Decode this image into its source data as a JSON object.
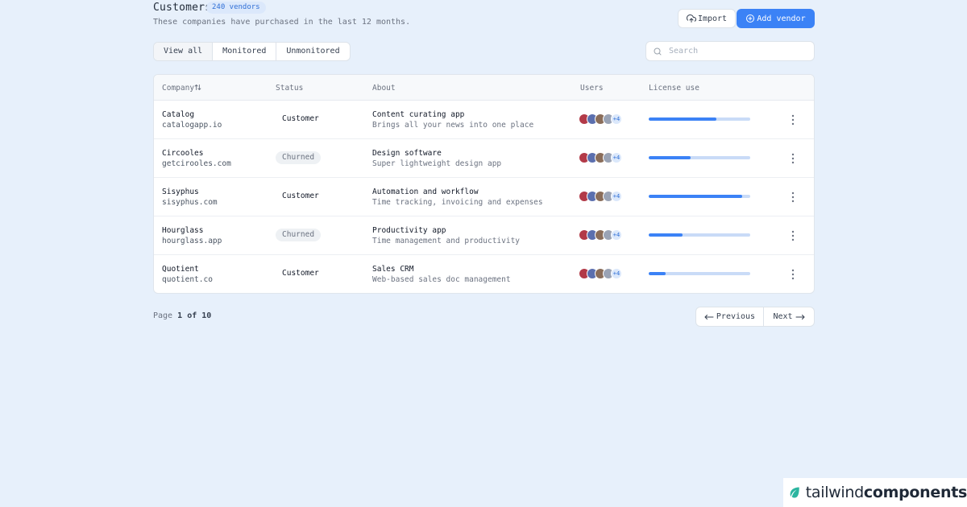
{
  "header": {
    "title": "Customers",
    "badge": "240 vendors",
    "subtitle": "These companies have purchased in the last 12 months.",
    "import_label": "Import",
    "add_label": "Add vendor"
  },
  "filters": {
    "tabs": [
      "View all",
      "Monitored",
      "Unmonitored"
    ],
    "active": "View all"
  },
  "search": {
    "placeholder": "Search"
  },
  "table": {
    "columns": {
      "company": "Company",
      "status": "Status",
      "about": "About",
      "users": "Users",
      "license": "License use"
    },
    "rows": [
      {
        "name": "Catalog",
        "domain": "catalogapp.io",
        "status": "Customer",
        "about_title": "Content curating app",
        "about_sub": "Brings all your news into one place",
        "extra_users": "+4",
        "license": 0.67
      },
      {
        "name": "Circooles",
        "domain": "getcirooles.com",
        "status": "Churned",
        "about_title": "Design software",
        "about_sub": "Super lightweight design app",
        "extra_users": "+4",
        "license": 0.41
      },
      {
        "name": "Sisyphus",
        "domain": "sisyphus.com",
        "status": "Customer",
        "about_title": "Automation and workflow",
        "about_sub": "Time tracking, invoicing and expenses",
        "extra_users": "+4",
        "license": 0.92
      },
      {
        "name": "Hourglass",
        "domain": "hourglass.app",
        "status": "Churned",
        "about_title": "Productivity app",
        "about_sub": "Time management and productivity",
        "extra_users": "+4",
        "license": 0.33
      },
      {
        "name": "Quotient",
        "domain": "quotient.co",
        "status": "Customer",
        "about_title": "Sales CRM",
        "about_sub": "Web-based sales doc management",
        "extra_users": "+4",
        "license": 0.17
      }
    ]
  },
  "pagination": {
    "page_prefix": "Page",
    "current": "1",
    "of_word": "of",
    "total": "10",
    "prev_label": "Previous",
    "next_label": "Next"
  },
  "brand": {
    "part1": "tailwind",
    "part2": "components"
  },
  "colors": {
    "accent": "#3b82f6",
    "background": "#e7f0fb",
    "avatar_palette": [
      "#b23a48",
      "#5b6fae",
      "#8a6d5a",
      "#9aa3b5"
    ]
  },
  "icons": {
    "import": "upload-cloud-icon",
    "add": "plus-circle-icon",
    "sort": "sort-icon",
    "search": "search-icon",
    "more": "more-vertical-icon",
    "prev": "arrow-left-icon",
    "next": "arrow-right-icon"
  }
}
